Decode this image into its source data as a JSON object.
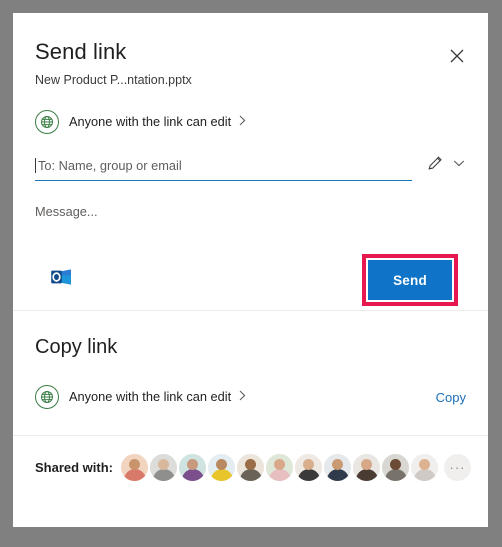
{
  "colors": {
    "page_background": "#808080",
    "card_background": "#ffffff",
    "accent_blue": "#0f74c8",
    "link_blue": "#1c6fb8",
    "underline_blue": "#1c74b8",
    "highlight_pink": "#e8174f",
    "permission_green": "#3a7d44",
    "divider": "#edebe9",
    "text_primary": "#201f1e",
    "text_secondary": "#605e5c"
  },
  "send_section": {
    "title": "Send link",
    "file_name": "New Product P...ntation.pptx",
    "close_icon": "close-icon",
    "permission": {
      "icon": "globe-icon",
      "label": "Anyone with the link can edit",
      "chevron_icon": "chevron-right-icon"
    },
    "to_field": {
      "placeholder": "To: Name, group or email",
      "value": "",
      "pencil_icon": "pencil-icon",
      "chevron_icon": "chevron-down-icon"
    },
    "message_field": {
      "placeholder": "Message...",
      "value": ""
    },
    "outlook_icon": "outlook-icon",
    "send_label": "Send"
  },
  "copy_section": {
    "title": "Copy link",
    "permission": {
      "icon": "globe-icon",
      "label": "Anyone with the link can edit",
      "chevron_icon": "chevron-right-icon"
    },
    "copy_label": "Copy"
  },
  "shared_section": {
    "label": "Shared with:",
    "overflow_label": "···",
    "avatars": [
      {
        "name": "avatar-1",
        "bg": "#f2d5c0",
        "head": "#c9936c",
        "body": "#d8796a"
      },
      {
        "name": "avatar-2",
        "bg": "#dcdcda",
        "head": "#d8b99c",
        "body": "#8f8f8d"
      },
      {
        "name": "avatar-3",
        "bg": "#cfe3e0",
        "head": "#c79a7d",
        "body": "#7a4f8c"
      },
      {
        "name": "avatar-4",
        "bg": "#e4eef2",
        "head": "#b98a62",
        "body": "#e9c52c"
      },
      {
        "name": "avatar-5",
        "bg": "#ece5dc",
        "head": "#9a6c47",
        "body": "#6b6257"
      },
      {
        "name": "avatar-6",
        "bg": "#dfe8d8",
        "head": "#d9a88a",
        "body": "#e8bfc0"
      },
      {
        "name": "avatar-7",
        "bg": "#efe9e4",
        "head": "#d8ae8c",
        "body": "#3a3a3a"
      },
      {
        "name": "avatar-8",
        "bg": "#e6e9ec",
        "head": "#c99a72",
        "body": "#2f3a4a"
      },
      {
        "name": "avatar-9",
        "bg": "#eae6e2",
        "head": "#d6a888",
        "body": "#4a3b33"
      },
      {
        "name": "avatar-10",
        "bg": "#d9d7d2",
        "head": "#6b4a36",
        "body": "#77736a"
      },
      {
        "name": "avatar-11",
        "bg": "#f1efee",
        "head": "#ddb291",
        "body": "#cfcac4"
      }
    ]
  }
}
